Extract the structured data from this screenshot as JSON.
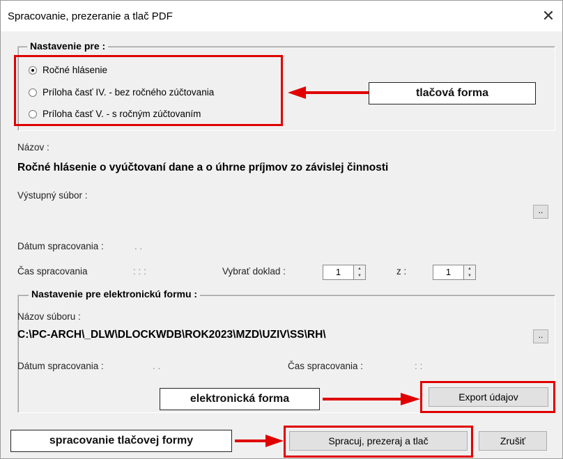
{
  "window": {
    "title": "Spracovanie, prezeranie a tlač PDF",
    "close_icon": "close-icon"
  },
  "settings": {
    "legend": "Nastavenie pre :",
    "options": [
      {
        "label": "Ročné hlásenie",
        "selected": true
      },
      {
        "label": "Príloha časť IV. - bez ročného zúčtovania",
        "selected": false
      },
      {
        "label": "Príloha časť V.  - s ročným zúčtovaním",
        "selected": false
      }
    ]
  },
  "form": {
    "name_label": "Názov :",
    "name_value": "Ročné hlásenie o vyúčtovaní dane a o úhrne príjmov zo závislej činnosti",
    "output_file_label": "Výstupný súbor :",
    "browse_label": "..",
    "date_label": "Dátum spracovania :",
    "date_value": ". .",
    "time_label": "Čas spracovania",
    "time_value": ": : :",
    "select_doc_label": "Vybrať doklad :",
    "select_doc_value": "1",
    "of_label": "z :",
    "of_value": "1"
  },
  "electronic": {
    "legend": "Nastavenie pre elektronickú formu :",
    "file_label": "Názov súboru :",
    "file_value": "C:\\PC-ARCH\\_DLW\\DLOCKWDB\\ROK2023\\MZD\\UZIV\\SS\\RH\\",
    "browse_label": "..",
    "date_label": "Dátum spracovania :",
    "date_value": ". .",
    "time_label": "Čas spracovania :",
    "time_value": ": :",
    "export_label": "Export údajov"
  },
  "buttons": {
    "process_label": "Spracuj, prezeraj a tlač",
    "cancel_label": "Zrušiť"
  },
  "annotations": {
    "print_form": "tlačová forma",
    "electronic_form": "elektronická forma",
    "print_processing": "spracovanie tlačovej formy",
    "accent_color": "#e00000"
  }
}
